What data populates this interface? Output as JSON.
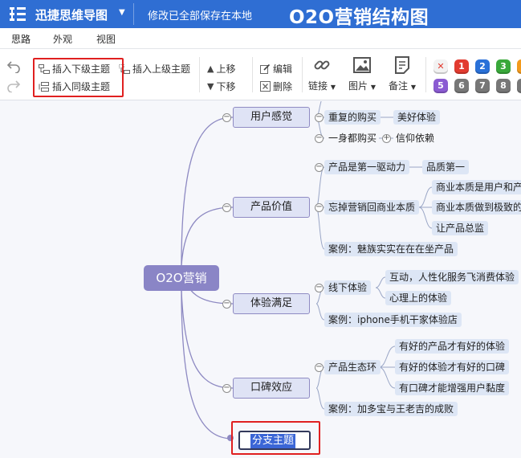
{
  "app": {
    "title": "迅捷思维导图",
    "save_status": "修改已全部保存在本地",
    "doc_title": "O2O营销结构图"
  },
  "tabs": [
    "思路",
    "外观",
    "视图"
  ],
  "toolbar": {
    "insert_child": "插入下级主题",
    "insert_parent": "插入上级主题",
    "insert_sibling": "插入同级主题",
    "move_up": "上移",
    "move_down": "下移",
    "edit": "编辑",
    "delete": "删除",
    "link": "链接",
    "image": "图片",
    "note": "备注",
    "priority_row1": [
      "✕",
      "1",
      "2",
      "3",
      "4"
    ],
    "priority_row2": [
      "5",
      "6",
      "7",
      "8",
      "9"
    ],
    "priority_colors_row1": [
      "#f2f2f2",
      "#e23b30",
      "#2a71d8",
      "#39a83a",
      "#f39a1c"
    ],
    "priority_colors_row2": [
      "#8b5bd2",
      "#777777",
      "#777777",
      "#777777",
      "#777777"
    ]
  },
  "map": {
    "root": "O2O营销",
    "branches": [
      {
        "label": "用户感觉",
        "items": [
          "重复的购买",
          "美好体验",
          "一身都购买",
          "信仰依赖"
        ]
      },
      {
        "label": "产品价值",
        "items": [
          "产品是第一驱动力",
          "品质第一",
          "忘掉营销回商业本质",
          "商业本质是用户和产",
          "商业本质做到极致的",
          "让产品总监",
          "案例：魅族实实在在在坐产品"
        ]
      },
      {
        "label": "体验满足",
        "items": [
          "线下体验",
          "互动，人性化服务飞消费体验",
          "心理上的体验",
          "案例：iphone手机干家体验店"
        ]
      },
      {
        "label": "口碑效应",
        "items": [
          "产品生态环",
          "有好的产品才有好的体验",
          "有好的体验才有好的口碑",
          "有口碑才能增强用户黏度",
          "案例：加多宝与王老吉的成败"
        ]
      }
    ],
    "new_topic": "分支主题"
  }
}
